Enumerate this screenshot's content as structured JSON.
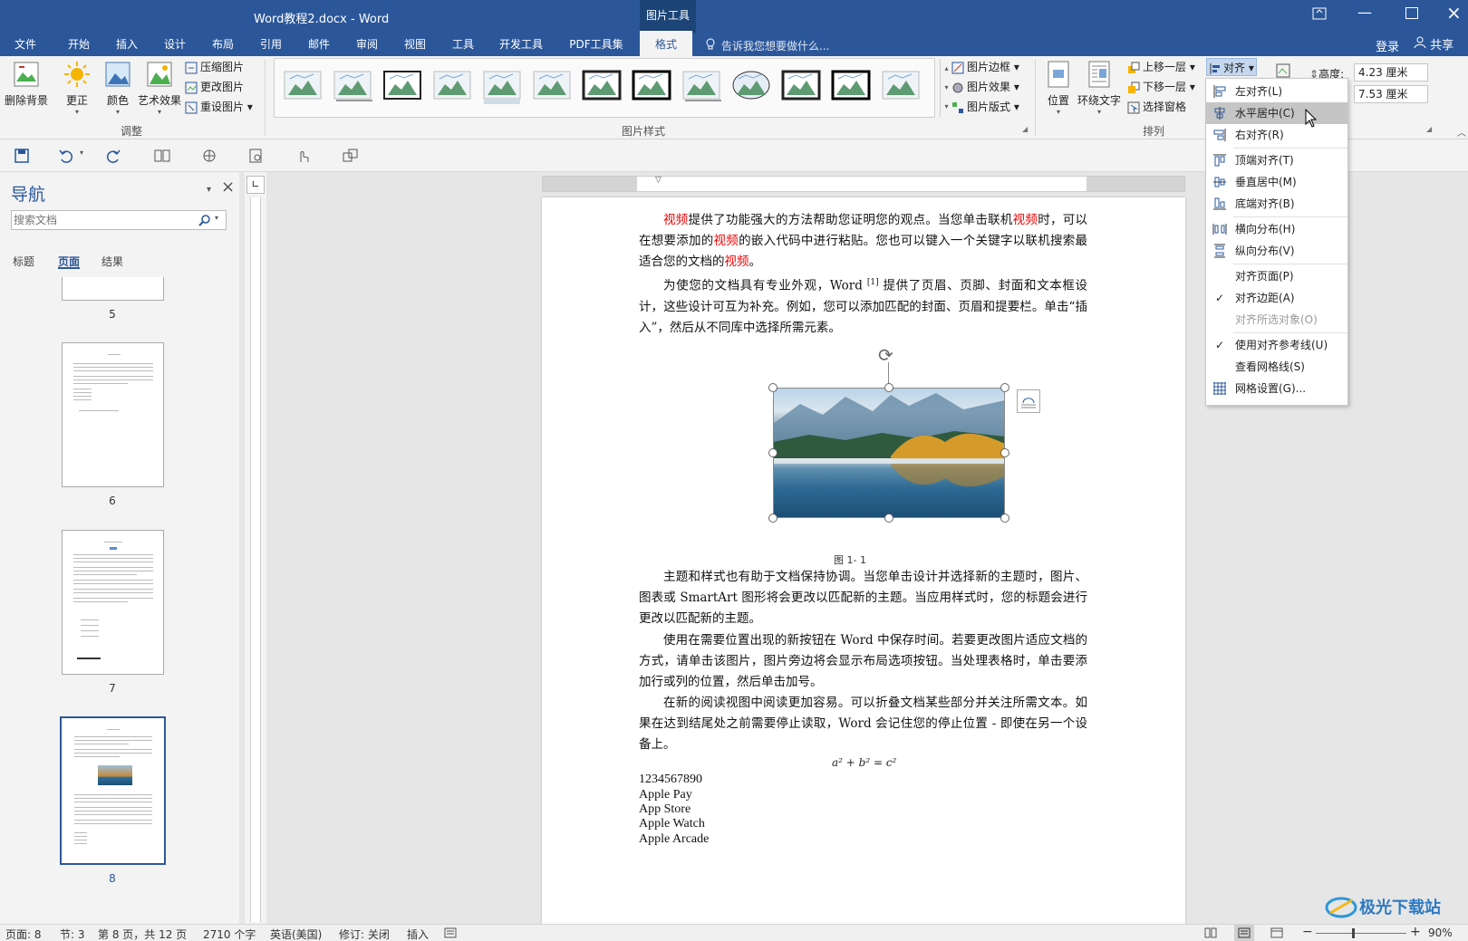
{
  "title_bar": {
    "doc_title": "Word教程2.docx - Word",
    "context_tool": "图片工具"
  },
  "tabs": {
    "file": "文件",
    "home": "开始",
    "insert": "插入",
    "design": "设计",
    "layout": "布局",
    "references": "引用",
    "mailings": "邮件",
    "review": "审阅",
    "view": "视图",
    "tools": "工具",
    "developer": "开发工具",
    "pdf": "PDF工具集",
    "format": "格式",
    "tell_me": "告诉我您想要做什么...",
    "login": "登录",
    "share": "共享"
  },
  "ribbon": {
    "adjust": {
      "remove_bg": "删除背景",
      "corrections": "更正",
      "color": "颜色",
      "artistic": "艺术效果",
      "compress": "压缩图片",
      "change": "更改图片",
      "reset": "重设图片",
      "group": "调整"
    },
    "styles": {
      "border": "图片边框",
      "effects": "图片效果",
      "layout": "图片版式",
      "group": "图片样式"
    },
    "arrange": {
      "position": "位置",
      "wrap": "环绕文字",
      "bring_forward": "上移一层",
      "send_backward": "下移一层",
      "selection_pane": "选择窗格",
      "align": "对齐",
      "group": "排列"
    },
    "size": {
      "height_label": "高度:",
      "height_value": "4.23 厘米",
      "width_value": "7.53 厘米"
    }
  },
  "align_menu": {
    "left": "左对齐(L)",
    "center": "水平居中(C)",
    "right": "右对齐(R)",
    "top": "顶端对齐(T)",
    "middle": "垂直居中(M)",
    "bottom": "底端对齐(B)",
    "dist_h": "横向分布(H)",
    "dist_v": "纵向分布(V)",
    "to_page": "对齐页面(P)",
    "to_margin": "对齐边距(A)",
    "to_selected": "对齐所选对象(O)",
    "use_guides": "使用对齐参考线(U)",
    "view_gridlines": "查看网格线(S)",
    "grid_settings": "网格设置(G)..."
  },
  "nav_pane": {
    "title": "导航",
    "search_placeholder": "搜索文档",
    "tab_headings": "标题",
    "tab_pages": "页面",
    "tab_results": "结果",
    "page_numbers": [
      "5",
      "6",
      "7",
      "8"
    ]
  },
  "document": {
    "p1_a": "视频",
    "p1_b": "提供了功能强大的方法帮助您证明您的观点。当您单击联机",
    "p1_c": "视频",
    "p1_d": "时，可以在想要添加的",
    "p1_e": "视频",
    "p1_f": "的嵌入代码中进行粘贴。您也可以键入一个关键字以联机搜索最适合您的文档的",
    "p1_g": "视频",
    "p1_h": "。",
    "p2_a": "为使您的文档具有专业外观，Word ",
    "p2_ref": "[1]",
    "p2_b": " 提供了页眉、页脚、封面和文本框设计，这些设计可互为补充。例如，您可以添加匹配的封面、页眉和提要栏。单击“插入”，然后从不同库中选择所需元素。",
    "caption": "图 1- 1",
    "p3": "主题和样式也有助于文档保持协调。当您单击设计并选择新的主题时，图片、图表或 SmartArt 图形将会更改以匹配新的主题。当应用样式时，您的标题会进行更改以匹配新的主题。",
    "p4": "使用在需要位置出现的新按钮在 Word 中保存时间。若要更改图片适应文档的方式，请单击该图片，图片旁边将会显示布局选项按钮。当处理表格时，单击要添加行或列的位置，然后单击加号。",
    "p5": "在新的阅读视图中阅读更加容易。可以折叠文档某些部分并关注所需文本。如果在达到结尾处之前需要停止读取，Word 会记住您的停止位置 - 即使在另一个设备上。",
    "formula": "a² + b² = c²",
    "lines": [
      "1234567890",
      "Apple Pay",
      "App Store",
      "Apple Watch",
      "Apple Arcade"
    ]
  },
  "status_bar": {
    "page": "页面: 8",
    "section": "节: 3",
    "page_of": "第 8 页，共 12 页",
    "words": "2710 个字",
    "language": "英语(美国)",
    "track": "修订: 关闭",
    "insert_mode": "插入",
    "zoom": "90%"
  },
  "watermark": "极光下载站",
  "colors": {
    "word_blue": "#2b579a",
    "accent_red": "#e00000"
  }
}
